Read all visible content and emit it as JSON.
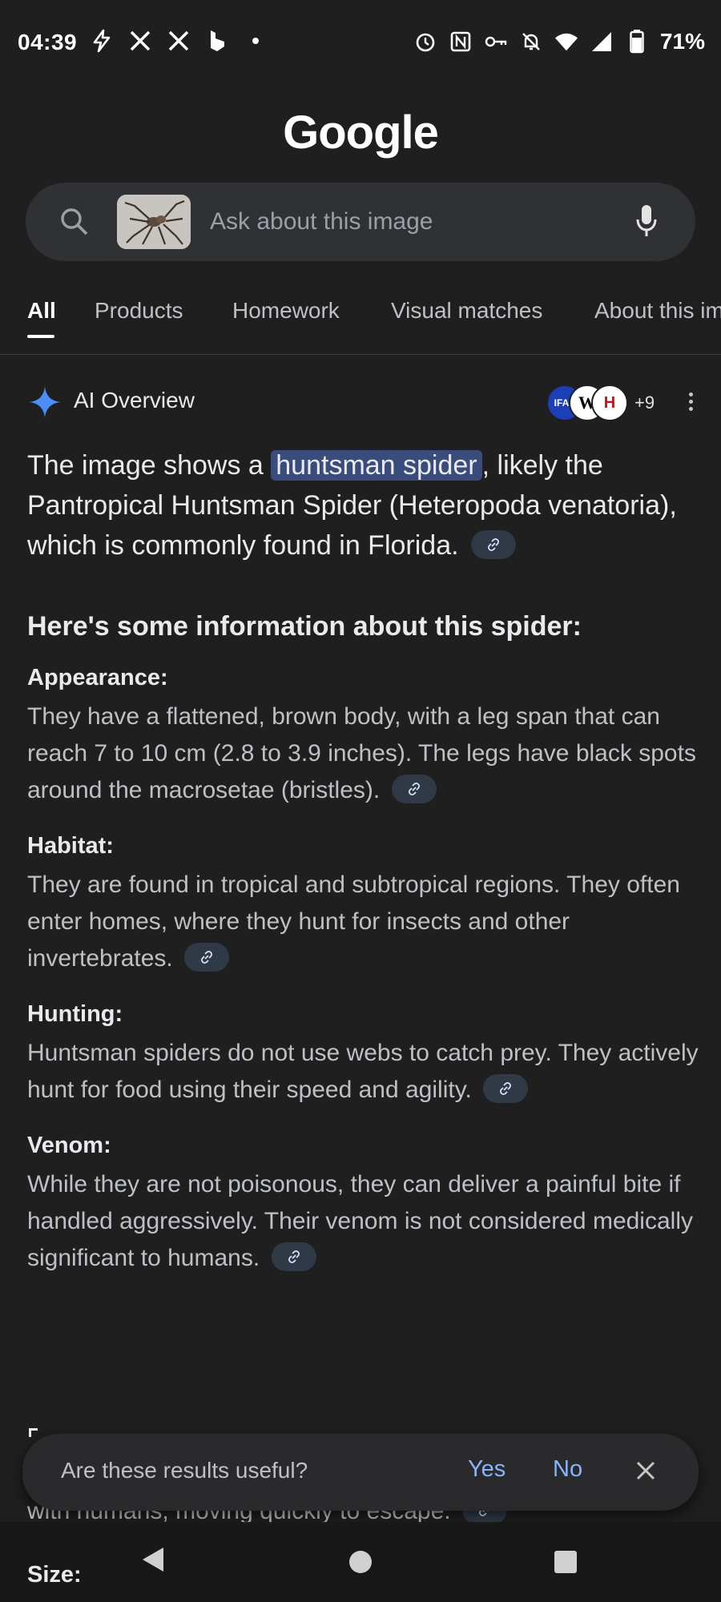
{
  "status_bar": {
    "time": "04:39",
    "battery": "71%",
    "left_icons": [
      "flash-icon",
      "x-icon",
      "x-icon",
      "bing-icon",
      "dot-icon"
    ],
    "right_icons": [
      "alarm-icon",
      "nfc-icon",
      "vpn-key-icon",
      "bell-off-icon",
      "wifi-icon",
      "signal-icon",
      "battery-icon"
    ]
  },
  "header": {
    "logo": "Google"
  },
  "search": {
    "placeholder": "Ask about this image"
  },
  "tabs": [
    "All",
    "Products",
    "Homework",
    "Visual matches",
    "About this image"
  ],
  "ai_overview": {
    "title": "AI Overview",
    "source_badges": [
      "IFAS",
      "W",
      "H"
    ],
    "more_sources": "+9"
  },
  "content": {
    "lead_before": "The image shows a ",
    "lead_highlight": "huntsman spider",
    "lead_after": ", likely the Pantropical Huntsman Spider (Heteropoda venatoria), which is commonly found in Florida.",
    "subheading": "Here's some information about this spider:",
    "sections": [
      {
        "title": "Appearance:",
        "body": "They have a flattened, brown body, with a leg span that can reach 7 to 10 cm (2.8 to 3.9 inches). The legs have black spots around the macrosetae (bristles)."
      },
      {
        "title": "Habitat:",
        "body": "They are found in tropical and subtropical regions. They often enter homes, where they hunt for insects and other invertebrates."
      },
      {
        "title": "Hunting:",
        "body": "Huntsman spiders do not use webs to catch prey. They actively hunt for food using their speed and agility."
      },
      {
        "title": "Venom:",
        "body": "While they are not poisonous, they can deliver a painful bite if handled aggressively. Their venom is not considered medically significant to humans."
      }
    ],
    "partial_line": "with humans, moving quickly to escape.",
    "next_section_title": "Size:"
  },
  "feedback": {
    "question": "Are these results useful?",
    "yes": "Yes",
    "no": "No"
  },
  "colors": {
    "background": "#1f1f1f",
    "accent": "#8ab4f8",
    "highlight": "#394c7c"
  }
}
